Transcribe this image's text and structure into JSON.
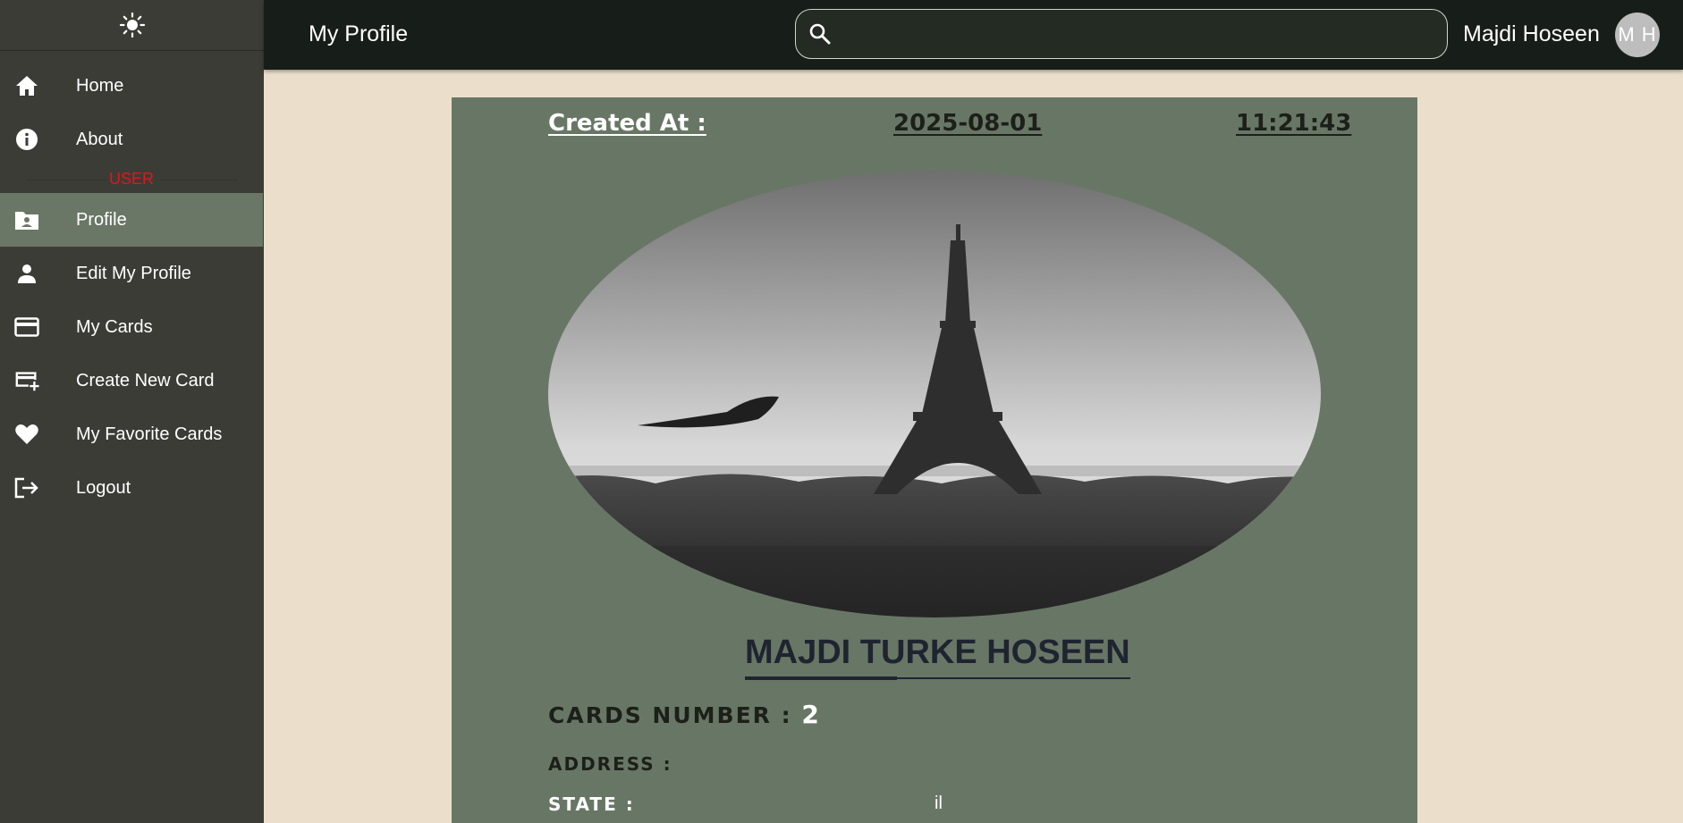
{
  "sidebar": {
    "theme_icon": "sun-icon",
    "role_label": "USER",
    "items": [
      {
        "label": "Home",
        "icon": "home-icon"
      },
      {
        "label": "About",
        "icon": "info-icon"
      },
      {
        "label": "Profile",
        "icon": "folder-user-icon",
        "active": true
      },
      {
        "label": "Edit My Profile",
        "icon": "person-icon"
      },
      {
        "label": "My Cards",
        "icon": "credit-card-icon"
      },
      {
        "label": "Create New Card",
        "icon": "card-add-icon"
      },
      {
        "label": "My Favorite Cards",
        "icon": "heart-icon"
      },
      {
        "label": "Logout",
        "icon": "logout-icon"
      }
    ]
  },
  "header": {
    "title": "My Profile",
    "search_placeholder": "",
    "user_name": "Majdi Hoseen",
    "avatar_initials": "M H"
  },
  "profile": {
    "created_label": "Created At :",
    "created_date": "2025-08-01",
    "created_time": "11:21:43",
    "full_name": "MAJDI TURKE HOSEEN",
    "cards_number_label": "CARDS NUMBER :",
    "cards_number": "2",
    "address_label": "ADDRESS :",
    "state_label": "STATE :",
    "state_value": "il"
  },
  "colors": {
    "sidebar_bg": "#3c3c36",
    "active_item_bg": "#6a7766",
    "topbar_bg": "#171d18",
    "page_bg": "#ebdfcc",
    "card_bg": "#687765",
    "role_label": "#e0161b"
  }
}
